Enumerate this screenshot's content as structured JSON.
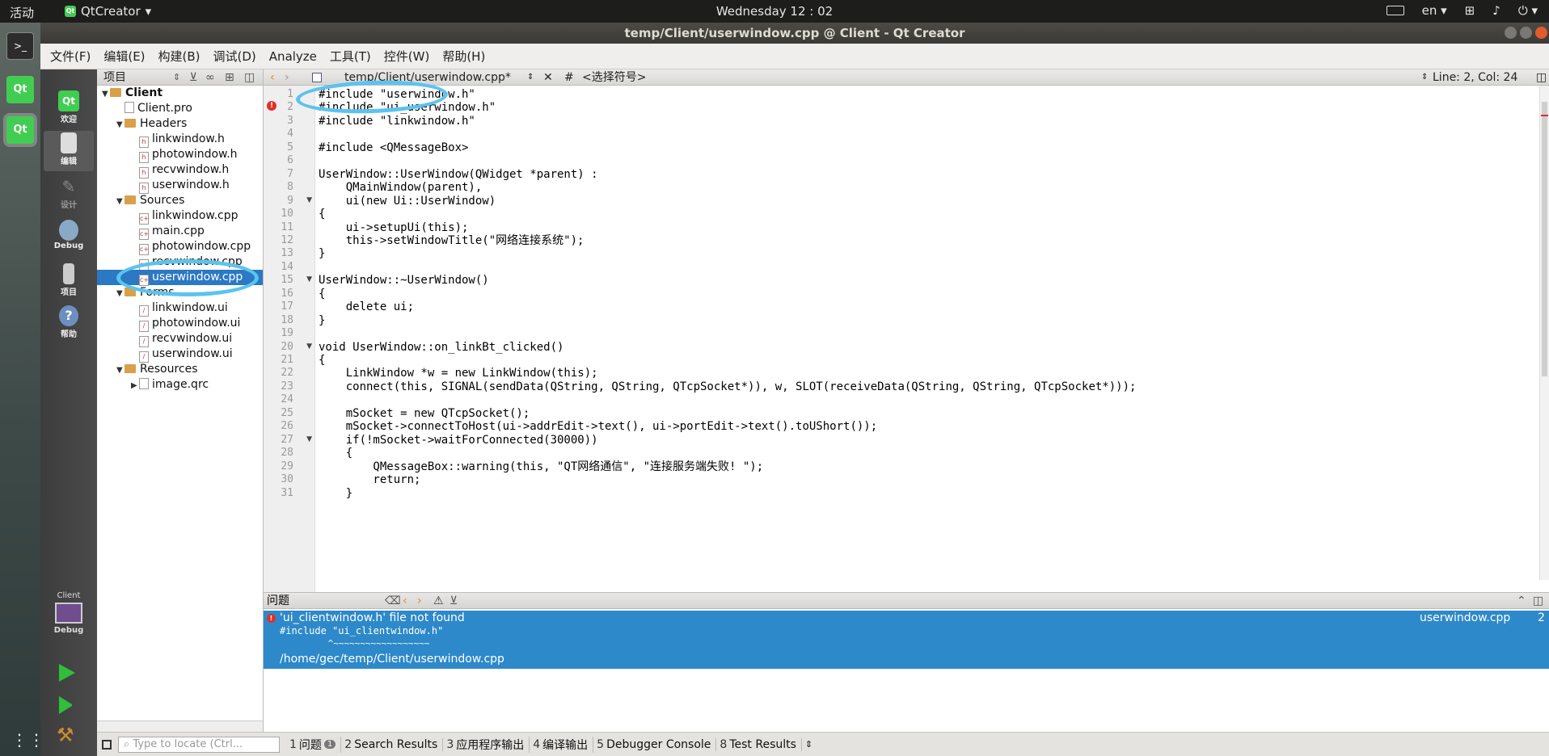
{
  "topbar": {
    "activities": "活动",
    "app_name": "QtCreator",
    "clock": "Wednesday 12 : 02",
    "lang": "en"
  },
  "window": {
    "title": "temp/Client/userwindow.cpp @ Client - Qt Creator"
  },
  "menu": [
    "文件(F)",
    "编辑(E)",
    "构建(B)",
    "调试(D)",
    "Analyze",
    "工具(T)",
    "控件(W)",
    "帮助(H)"
  ],
  "modes": [
    {
      "label": "欢迎",
      "icon": "qt-logo-icon"
    },
    {
      "label": "编辑",
      "icon": "edit-document-icon"
    },
    {
      "label": "设计",
      "icon": "design-brush-icon"
    },
    {
      "label": "Debug",
      "icon": "debug-bug-icon"
    },
    {
      "label": "项目",
      "icon": "project-wrench-icon"
    },
    {
      "label": "帮助",
      "icon": "help-icon"
    }
  ],
  "kit": {
    "project": "Client",
    "config": "Debug"
  },
  "project_panel": {
    "title": "项目"
  },
  "tree": [
    {
      "indent": 0,
      "twisty": "▼",
      "type": "project",
      "label": "Client",
      "bold": true
    },
    {
      "indent": 1,
      "twisty": "",
      "type": "file",
      "label": "Client.pro"
    },
    {
      "indent": 1,
      "twisty": "▼",
      "type": "folder",
      "label": "Headers"
    },
    {
      "indent": 2,
      "twisty": "",
      "type": "h",
      "label": "linkwindow.h"
    },
    {
      "indent": 2,
      "twisty": "",
      "type": "h",
      "label": "photowindow.h"
    },
    {
      "indent": 2,
      "twisty": "",
      "type": "h",
      "label": "recvwindow.h"
    },
    {
      "indent": 2,
      "twisty": "",
      "type": "h",
      "label": "userwindow.h"
    },
    {
      "indent": 1,
      "twisty": "▼",
      "type": "folder",
      "label": "Sources"
    },
    {
      "indent": 2,
      "twisty": "",
      "type": "cpp",
      "label": "linkwindow.cpp"
    },
    {
      "indent": 2,
      "twisty": "",
      "type": "cpp",
      "label": "main.cpp"
    },
    {
      "indent": 2,
      "twisty": "",
      "type": "cpp",
      "label": "photowindow.cpp"
    },
    {
      "indent": 2,
      "twisty": "",
      "type": "cpp",
      "label": "recvwindow.cpp"
    },
    {
      "indent": 2,
      "twisty": "",
      "type": "cpp",
      "label": "userwindow.cpp",
      "selected": true
    },
    {
      "indent": 1,
      "twisty": "▼",
      "type": "folder",
      "label": "Forms"
    },
    {
      "indent": 2,
      "twisty": "",
      "type": "ui",
      "label": "linkwindow.ui"
    },
    {
      "indent": 2,
      "twisty": "",
      "type": "ui",
      "label": "photowindow.ui"
    },
    {
      "indent": 2,
      "twisty": "",
      "type": "ui",
      "label": "recvwindow.ui"
    },
    {
      "indent": 2,
      "twisty": "",
      "type": "ui",
      "label": "userwindow.ui"
    },
    {
      "indent": 1,
      "twisty": "▼",
      "type": "folder",
      "label": "Resources"
    },
    {
      "indent": 2,
      "twisty": "▶",
      "type": "qrc",
      "label": "image.qrc"
    }
  ],
  "editor": {
    "file": "temp/Client/userwindow.cpp*",
    "symbol": "<选择符号>",
    "position": "Line: 2, Col: 24"
  },
  "code": [
    "#include \"userwindow.h\"",
    "#include \"ui_userwindow.h\"",
    "#include \"linkwindow.h\"",
    "",
    "#include <QMessageBox>",
    "",
    "UserWindow::UserWindow(QWidget *parent) :",
    "    QMainWindow(parent),",
    "    ui(new Ui::UserWindow)",
    "{",
    "    ui->setupUi(this);",
    "    this->setWindowTitle(\"网络连接系统\");",
    "}",
    "",
    "UserWindow::~UserWindow()",
    "{",
    "    delete ui;",
    "}",
    "",
    "void UserWindow::on_linkBt_clicked()",
    "{",
    "    LinkWindow *w = new LinkWindow(this);",
    "    connect(this, SIGNAL(sendData(QString, QString, QTcpSocket*)), w, SLOT(receiveData(QString, QString, QTcpSocket*)));",
    "",
    "    mSocket = new QTcpSocket();",
    "    mSocket->connectToHost(ui->addrEdit->text(), ui->portEdit->text().toUShort());",
    "    if(!mSocket->waitForConnected(30000))",
    "    {",
    "        QMessageBox::warning(this, \"QT网络通信\", \"连接服务端失败! \");",
    "        return;",
    "    }"
  ],
  "issues": {
    "title": "问题",
    "message": "'ui_clientwindow.h' file not found",
    "detail_line1": "#include \"ui_clientwindow.h\"",
    "detail_line2": "         ^~~~~~~~~~~~~~~~~~~",
    "path": "/home/gec/temp/Client/userwindow.cpp",
    "file": "userwindow.cpp",
    "line": "2"
  },
  "statusbar": {
    "locate_placeholder": "Type to locate (Ctrl...",
    "tabs": [
      {
        "num": "1",
        "label": "问题",
        "badge": "1"
      },
      {
        "num": "2",
        "label": "Search Results"
      },
      {
        "num": "3",
        "label": "应用程序输出"
      },
      {
        "num": "4",
        "label": "编译输出"
      },
      {
        "num": "5",
        "label": "Debugger Console"
      },
      {
        "num": "8",
        "label": "Test Results"
      }
    ]
  },
  "colors": {
    "accent": "#2b78c5",
    "issue_bg": "#2d89c9",
    "annotation": "#5cc3ef",
    "error": "#e0302a"
  }
}
